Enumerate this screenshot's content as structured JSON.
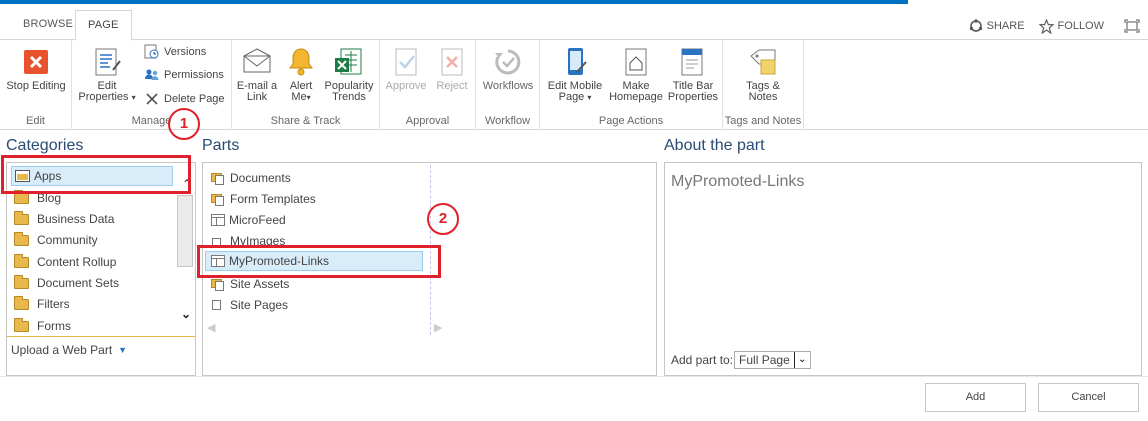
{
  "tabs": {
    "browse": "BROWSE",
    "page": "PAGE"
  },
  "top_actions": {
    "share": "SHARE",
    "follow": "FOLLOW"
  },
  "ribbon": {
    "edit": {
      "stop_editing": "Stop Editing",
      "group": "Edit"
    },
    "manage": {
      "edit_properties_1": "Edit",
      "edit_properties_2": "Properties",
      "versions": "Versions",
      "permissions": "Permissions",
      "delete_page": "Delete Page",
      "group": "Manage"
    },
    "share_track": {
      "email_1": "E-mail a",
      "email_2": "Link",
      "alert_1": "Alert",
      "alert_2": "Me",
      "popularity_1": "Popularity",
      "popularity_2": "Trends",
      "group": "Share & Track"
    },
    "approval": {
      "approve": "Approve",
      "reject": "Reject",
      "group": "Approval"
    },
    "workflow": {
      "workflows": "Workflows",
      "group": "Workflow"
    },
    "page_actions": {
      "mobile_1": "Edit Mobile",
      "mobile_2": "Page",
      "homepage_1": "Make",
      "homepage_2": "Homepage",
      "titlebar_1": "Title Bar",
      "titlebar_2": "Properties",
      "group": "Page Actions"
    },
    "tags_notes": {
      "tags_1": "Tags &",
      "tags_2": "Notes",
      "group": "Tags and Notes"
    }
  },
  "categories": {
    "title": "Categories",
    "items": [
      "Apps",
      "Blog",
      "Business Data",
      "Community",
      "Content Rollup",
      "Document Sets",
      "Filters",
      "Forms"
    ],
    "upload": "Upload a Web Part"
  },
  "parts": {
    "title": "Parts",
    "items": [
      "Documents",
      "Form Templates",
      "MicroFeed",
      "MyImages",
      "MyPromoted-Links",
      "Site Assets",
      "Site Pages"
    ]
  },
  "about": {
    "title": "About the part",
    "part_name": "MyPromoted-Links",
    "add_part_to_label": "Add part to:",
    "add_part_to_value": "Full Page"
  },
  "buttons": {
    "add": "Add",
    "cancel": "Cancel"
  },
  "callouts": {
    "one": "1",
    "two": "2"
  },
  "colors": {
    "accent": "#0072c6",
    "callout": "#e0202a",
    "title": "#2a4b73"
  }
}
